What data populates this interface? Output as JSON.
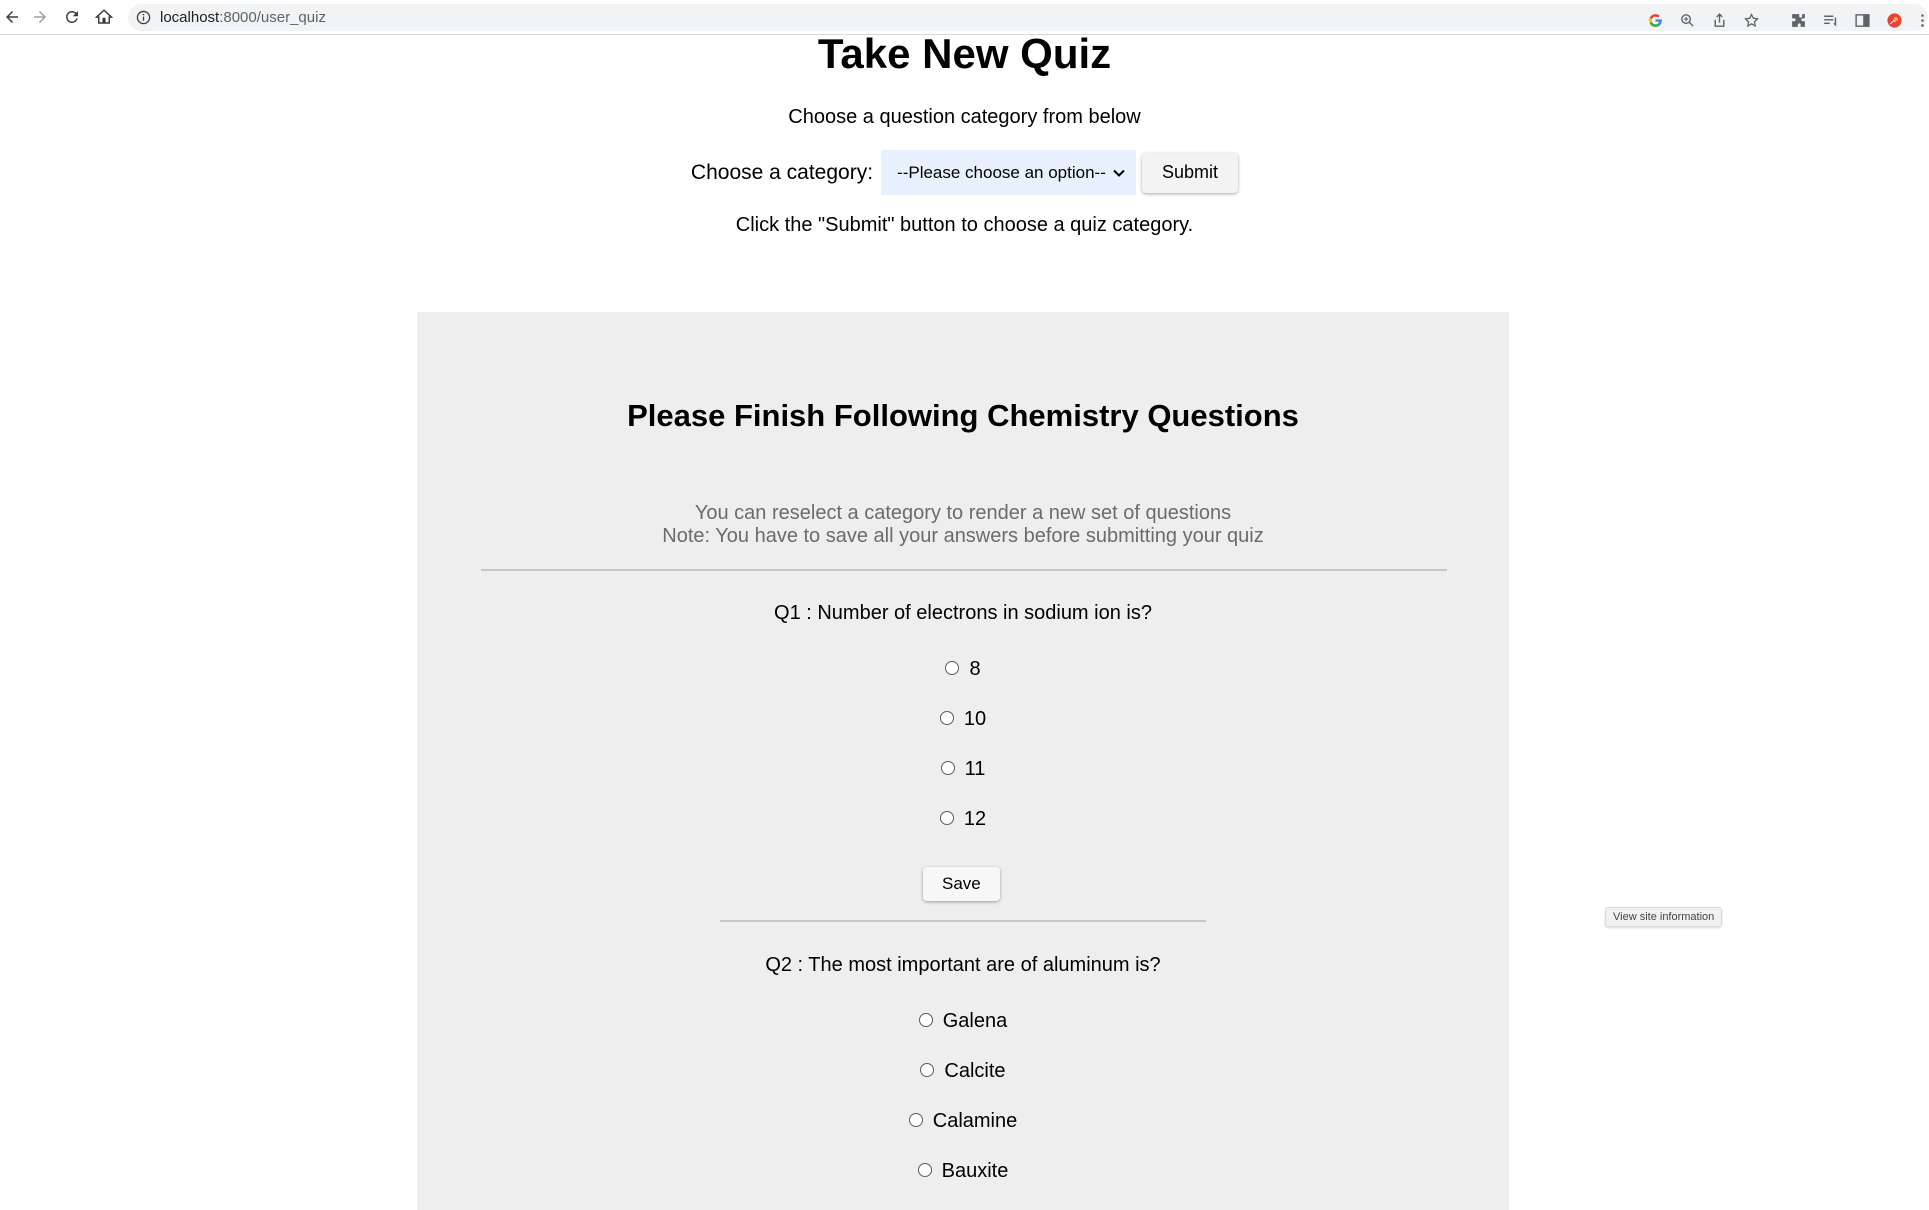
{
  "browser": {
    "url_host": "localhost",
    "url_path": ":8000/user_quiz",
    "tooltip": "View site information"
  },
  "page": {
    "title": "Take New Quiz",
    "subtitle": "Choose a question category from below",
    "category_label": "Choose a category:",
    "category_select_value": "--Please choose an option--",
    "submit_label": "Submit",
    "instruction": "Click the \"Submit\" button to choose a quiz category."
  },
  "quiz": {
    "heading": "Please Finish Following Chemistry Questions",
    "note_line1": "You can reselect a category to render a new set of questions",
    "note_line2": "Note: You have to save all your answers before submitting your quiz",
    "save_label": "Save",
    "questions": [
      {
        "text": "Q1 : Number of electrons in sodium ion is?",
        "options": [
          "8",
          "10",
          "11",
          "12"
        ]
      },
      {
        "text": "Q2 : The most important are of aluminum is?",
        "options": [
          "Galena",
          "Calcite",
          "Calamine",
          "Bauxite"
        ]
      }
    ]
  },
  "colors": {
    "panel_background": "#eeeeee",
    "select_background": "#e8f0fe",
    "note_text": "#6b6b6b"
  }
}
